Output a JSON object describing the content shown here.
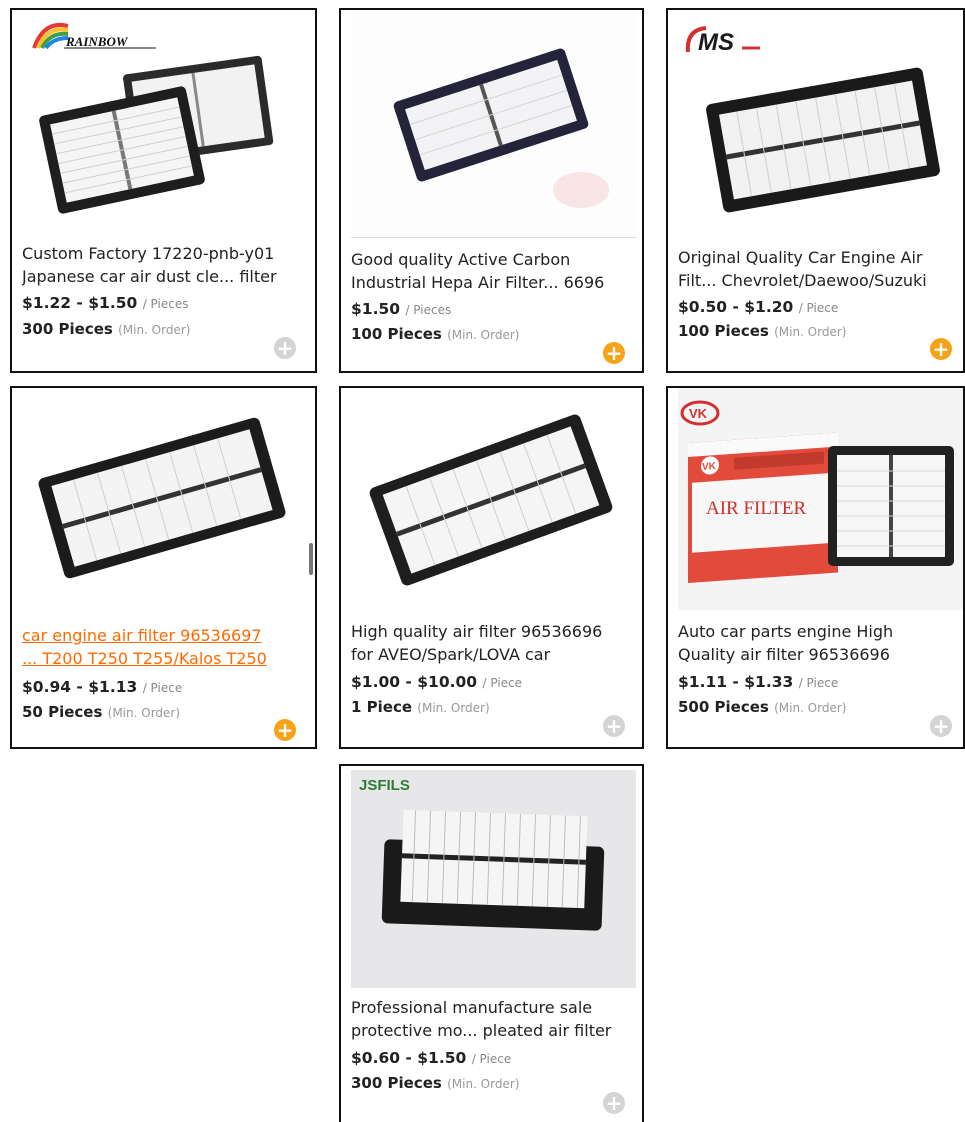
{
  "products": [
    {
      "title_line1": "Custom Factory 17220-pnb-y01",
      "title_line2": "Japanese car air dust cle... filter",
      "price": "$1.22 - $1.50",
      "unit": "/ Pieces",
      "moq": "300 Pieces",
      "moq_note": "(Min. Order)",
      "brand_logo": "RAINBOW",
      "add_state": "inactive"
    },
    {
      "title_line1": "Good quality Active Carbon",
      "title_line2": "Industrial Hepa Air Filter... 6696",
      "price": "$1.50",
      "unit": "/ Pieces",
      "moq": "100 Pieces",
      "moq_note": "(Min. Order)",
      "add_state": "active"
    },
    {
      "title_line1": "Original Quality Car Engine Air",
      "title_line2": "Filt... Chevrolet/Daewoo/Suzuki",
      "price": "$0.50 - $1.20",
      "unit": "/ Piece",
      "moq": "100 Pieces",
      "moq_note": "(Min. Order)",
      "brand_logo": "MS",
      "add_state": "active"
    },
    {
      "title_line1": "car engine air filter 96536697",
      "title_line2": "... T200 T250 T255/Kalos T250",
      "price": "$0.94 - $1.13",
      "unit": "/ Piece",
      "moq": "50 Pieces",
      "moq_note": "(Min. Order)",
      "add_state": "active"
    },
    {
      "title_line1": "High quality air filter 96536696",
      "title_line2": "for AVEO/Spark/LOVA car",
      "price": "$1.00 - $10.00",
      "unit": "/ Piece",
      "moq": "1 Piece",
      "moq_note": "(Min. Order)",
      "add_state": "inactive"
    },
    {
      "title_line1": "Auto car parts engine High",
      "title_line2": "Quality air filter 96536696",
      "price": "$1.11 - $1.33",
      "unit": "/ Piece",
      "moq": "500 Pieces",
      "moq_note": "(Min. Order)",
      "brand_logo": "VK",
      "box_text": "AIR FILTER",
      "add_state": "inactive"
    },
    {
      "title_line1": "Professional manufacture sale",
      "title_line2": "protective mo... pleated air filter",
      "price": "$0.60 - $1.50",
      "unit": "/ Piece",
      "moq": "300 Pieces",
      "moq_note": "(Min. Order)",
      "brand_logo": "JSFILS",
      "add_state": "inactive"
    }
  ],
  "colors": {
    "link": "#ff6a00",
    "add_active": "#f7a217",
    "add_inactive": "#d4d4d4",
    "border": "#111111"
  },
  "icons": {
    "add": "plus-circle-icon"
  }
}
